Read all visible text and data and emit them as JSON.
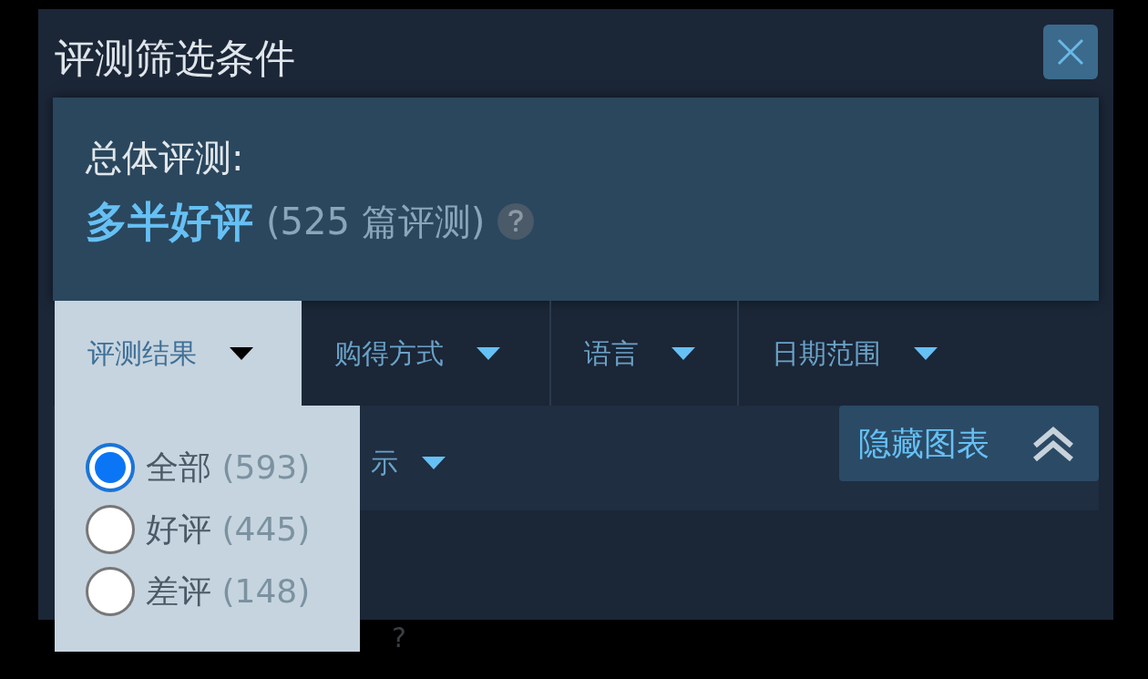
{
  "dialog": {
    "title": "评测筛选条件"
  },
  "summary": {
    "label": "总体评测:",
    "rating": "多半好评",
    "count": "(525 篇评测)"
  },
  "filter_tabs": [
    {
      "label": "评测结果",
      "selected": true
    },
    {
      "label": "购得方式",
      "selected": false
    },
    {
      "label": "语言",
      "selected": false
    },
    {
      "label": "日期范围",
      "selected": false
    }
  ],
  "second_row": {
    "partial_label": "示"
  },
  "hide_chart_button": {
    "label": "隐藏图表"
  },
  "dropdown_options": [
    {
      "label": "全部",
      "count": "(593)",
      "selected": true
    },
    {
      "label": "好评",
      "count": "(445)",
      "selected": false
    },
    {
      "label": "差评",
      "count": "(148)",
      "selected": false
    }
  ],
  "below_text": "?"
}
